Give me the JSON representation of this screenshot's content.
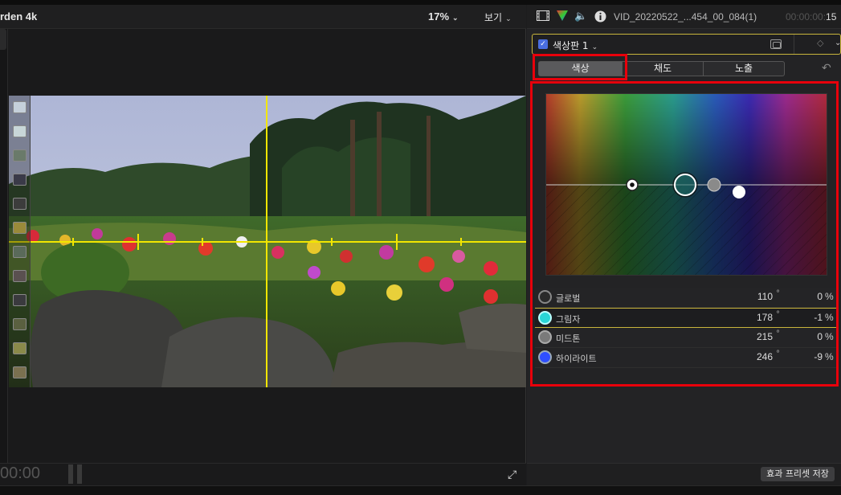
{
  "viewer": {
    "clip_title": "rden 4k",
    "zoom": "17%",
    "view_menu": "보기",
    "timecode": "00:00"
  },
  "inspector": {
    "file_name": "VID_20220522_...454_00_084(1)",
    "timecode_dim": "00:00:00:",
    "timecode_bright": "15",
    "board_name": "색상판 1",
    "tabs": [
      "색상",
      "채도",
      "노출"
    ],
    "active_tab": "색상",
    "save_preset_label": "효과 프리셋 저장",
    "rows": [
      {
        "label": "글로벌",
        "angle": "110",
        "angle_unit": "°",
        "percent": "0",
        "percent_unit": "%"
      },
      {
        "label": "그림자",
        "angle": "178",
        "angle_unit": "°",
        "percent": "-1",
        "percent_unit": "%"
      },
      {
        "label": "미드톤",
        "angle": "215",
        "angle_unit": "°",
        "percent": "0",
        "percent_unit": "%"
      },
      {
        "label": "하이라이트",
        "angle": "246",
        "angle_unit": "°",
        "percent": "-9",
        "percent_unit": "%"
      }
    ]
  },
  "icons": {
    "film": "film-icon",
    "color": "color-triangle-icon",
    "audio": "speaker-icon",
    "info": "info-icon",
    "reset": "reset-icon",
    "fullscreen": "fullscreen-icon"
  },
  "colors": {
    "accent_red": "#e8000b",
    "selection_yellow": "#c8b43c",
    "guide_yellow": "#f2e600",
    "shadow_puck": "#2ad6d6",
    "highlight_puck": "#2f4fff"
  }
}
